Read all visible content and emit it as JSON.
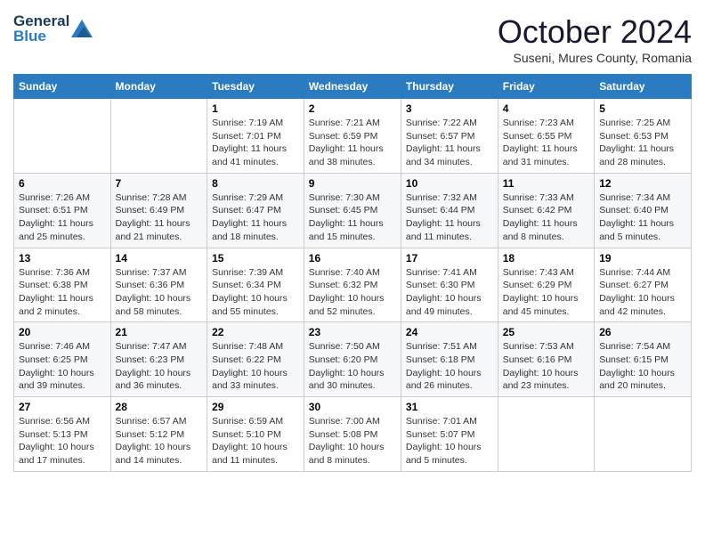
{
  "header": {
    "logo_line1": "General",
    "logo_line2": "Blue",
    "month_title": "October 2024",
    "subtitle": "Suseni, Mures County, Romania"
  },
  "days_of_week": [
    "Sunday",
    "Monday",
    "Tuesday",
    "Wednesday",
    "Thursday",
    "Friday",
    "Saturday"
  ],
  "weeks": [
    [
      {
        "day": "",
        "sunrise": "",
        "sunset": "",
        "daylight": ""
      },
      {
        "day": "",
        "sunrise": "",
        "sunset": "",
        "daylight": ""
      },
      {
        "day": "1",
        "sunrise": "Sunrise: 7:19 AM",
        "sunset": "Sunset: 7:01 PM",
        "daylight": "Daylight: 11 hours and 41 minutes."
      },
      {
        "day": "2",
        "sunrise": "Sunrise: 7:21 AM",
        "sunset": "Sunset: 6:59 PM",
        "daylight": "Daylight: 11 hours and 38 minutes."
      },
      {
        "day": "3",
        "sunrise": "Sunrise: 7:22 AM",
        "sunset": "Sunset: 6:57 PM",
        "daylight": "Daylight: 11 hours and 34 minutes."
      },
      {
        "day": "4",
        "sunrise": "Sunrise: 7:23 AM",
        "sunset": "Sunset: 6:55 PM",
        "daylight": "Daylight: 11 hours and 31 minutes."
      },
      {
        "day": "5",
        "sunrise": "Sunrise: 7:25 AM",
        "sunset": "Sunset: 6:53 PM",
        "daylight": "Daylight: 11 hours and 28 minutes."
      }
    ],
    [
      {
        "day": "6",
        "sunrise": "Sunrise: 7:26 AM",
        "sunset": "Sunset: 6:51 PM",
        "daylight": "Daylight: 11 hours and 25 minutes."
      },
      {
        "day": "7",
        "sunrise": "Sunrise: 7:28 AM",
        "sunset": "Sunset: 6:49 PM",
        "daylight": "Daylight: 11 hours and 21 minutes."
      },
      {
        "day": "8",
        "sunrise": "Sunrise: 7:29 AM",
        "sunset": "Sunset: 6:47 PM",
        "daylight": "Daylight: 11 hours and 18 minutes."
      },
      {
        "day": "9",
        "sunrise": "Sunrise: 7:30 AM",
        "sunset": "Sunset: 6:45 PM",
        "daylight": "Daylight: 11 hours and 15 minutes."
      },
      {
        "day": "10",
        "sunrise": "Sunrise: 7:32 AM",
        "sunset": "Sunset: 6:44 PM",
        "daylight": "Daylight: 11 hours and 11 minutes."
      },
      {
        "day": "11",
        "sunrise": "Sunrise: 7:33 AM",
        "sunset": "Sunset: 6:42 PM",
        "daylight": "Daylight: 11 hours and 8 minutes."
      },
      {
        "day": "12",
        "sunrise": "Sunrise: 7:34 AM",
        "sunset": "Sunset: 6:40 PM",
        "daylight": "Daylight: 11 hours and 5 minutes."
      }
    ],
    [
      {
        "day": "13",
        "sunrise": "Sunrise: 7:36 AM",
        "sunset": "Sunset: 6:38 PM",
        "daylight": "Daylight: 11 hours and 2 minutes."
      },
      {
        "day": "14",
        "sunrise": "Sunrise: 7:37 AM",
        "sunset": "Sunset: 6:36 PM",
        "daylight": "Daylight: 10 hours and 58 minutes."
      },
      {
        "day": "15",
        "sunrise": "Sunrise: 7:39 AM",
        "sunset": "Sunset: 6:34 PM",
        "daylight": "Daylight: 10 hours and 55 minutes."
      },
      {
        "day": "16",
        "sunrise": "Sunrise: 7:40 AM",
        "sunset": "Sunset: 6:32 PM",
        "daylight": "Daylight: 10 hours and 52 minutes."
      },
      {
        "day": "17",
        "sunrise": "Sunrise: 7:41 AM",
        "sunset": "Sunset: 6:30 PM",
        "daylight": "Daylight: 10 hours and 49 minutes."
      },
      {
        "day": "18",
        "sunrise": "Sunrise: 7:43 AM",
        "sunset": "Sunset: 6:29 PM",
        "daylight": "Daylight: 10 hours and 45 minutes."
      },
      {
        "day": "19",
        "sunrise": "Sunrise: 7:44 AM",
        "sunset": "Sunset: 6:27 PM",
        "daylight": "Daylight: 10 hours and 42 minutes."
      }
    ],
    [
      {
        "day": "20",
        "sunrise": "Sunrise: 7:46 AM",
        "sunset": "Sunset: 6:25 PM",
        "daylight": "Daylight: 10 hours and 39 minutes."
      },
      {
        "day": "21",
        "sunrise": "Sunrise: 7:47 AM",
        "sunset": "Sunset: 6:23 PM",
        "daylight": "Daylight: 10 hours and 36 minutes."
      },
      {
        "day": "22",
        "sunrise": "Sunrise: 7:48 AM",
        "sunset": "Sunset: 6:22 PM",
        "daylight": "Daylight: 10 hours and 33 minutes."
      },
      {
        "day": "23",
        "sunrise": "Sunrise: 7:50 AM",
        "sunset": "Sunset: 6:20 PM",
        "daylight": "Daylight: 10 hours and 30 minutes."
      },
      {
        "day": "24",
        "sunrise": "Sunrise: 7:51 AM",
        "sunset": "Sunset: 6:18 PM",
        "daylight": "Daylight: 10 hours and 26 minutes."
      },
      {
        "day": "25",
        "sunrise": "Sunrise: 7:53 AM",
        "sunset": "Sunset: 6:16 PM",
        "daylight": "Daylight: 10 hours and 23 minutes."
      },
      {
        "day": "26",
        "sunrise": "Sunrise: 7:54 AM",
        "sunset": "Sunset: 6:15 PM",
        "daylight": "Daylight: 10 hours and 20 minutes."
      }
    ],
    [
      {
        "day": "27",
        "sunrise": "Sunrise: 6:56 AM",
        "sunset": "Sunset: 5:13 PM",
        "daylight": "Daylight: 10 hours and 17 minutes."
      },
      {
        "day": "28",
        "sunrise": "Sunrise: 6:57 AM",
        "sunset": "Sunset: 5:12 PM",
        "daylight": "Daylight: 10 hours and 14 minutes."
      },
      {
        "day": "29",
        "sunrise": "Sunrise: 6:59 AM",
        "sunset": "Sunset: 5:10 PM",
        "daylight": "Daylight: 10 hours and 11 minutes."
      },
      {
        "day": "30",
        "sunrise": "Sunrise: 7:00 AM",
        "sunset": "Sunset: 5:08 PM",
        "daylight": "Daylight: 10 hours and 8 minutes."
      },
      {
        "day": "31",
        "sunrise": "Sunrise: 7:01 AM",
        "sunset": "Sunset: 5:07 PM",
        "daylight": "Daylight: 10 hours and 5 minutes."
      },
      {
        "day": "",
        "sunrise": "",
        "sunset": "",
        "daylight": ""
      },
      {
        "day": "",
        "sunrise": "",
        "sunset": "",
        "daylight": ""
      }
    ]
  ]
}
